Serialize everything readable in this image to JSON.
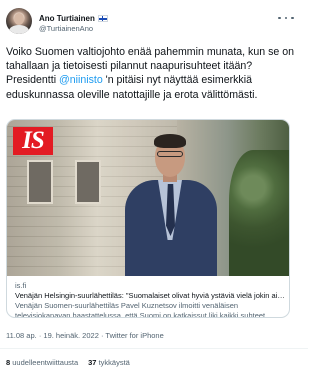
{
  "author": {
    "display_name": "Ano Turtiainen",
    "flag": "finland-flag-icon",
    "handle": "@TurtiainenAno"
  },
  "tweet": {
    "text_before_mention": "Voiko Suomen valtiojohto enää pahemmin munata, kun se on tahallaan ja tietoisesti pilannut naapurisuhteet itään? Presidentti ",
    "mention": "@niinisto",
    "text_after_mention": " 'n pitäisi nyt näyttää esimerkkiä eduskunnassa oleville natottajille ja erota välittömästi."
  },
  "card": {
    "logo_text": "IS",
    "domain": "is.fi",
    "title": "Venäjän Helsingin-suurlähettiläs: \"Suomalaiset olivat hyviä ystäviä vielä jokin aikaa sitten\"",
    "description": "Venäjän Suomen-suurlähettiläs Pavel Kuznetsov ilmoitti venäläisen televisiokanavan haastattelussa, että Suomi on katkaissut liki kaikki suhteet ..."
  },
  "meta": {
    "time": "11.08 ap.",
    "separator_1": " · ",
    "date": "19. heinäk. 2022",
    "separator_2": " · ",
    "client": "Twitter for iPhone"
  },
  "stats": {
    "retweets_count": "8",
    "retweets_label": " uudelleentwiittausta",
    "likes_count": "37",
    "likes_label": " tykkäystä"
  },
  "colors": {
    "accent": "#1d9bf0",
    "text_primary": "#0f1419",
    "text_secondary": "#536471",
    "logo_red": "#e31b23"
  }
}
